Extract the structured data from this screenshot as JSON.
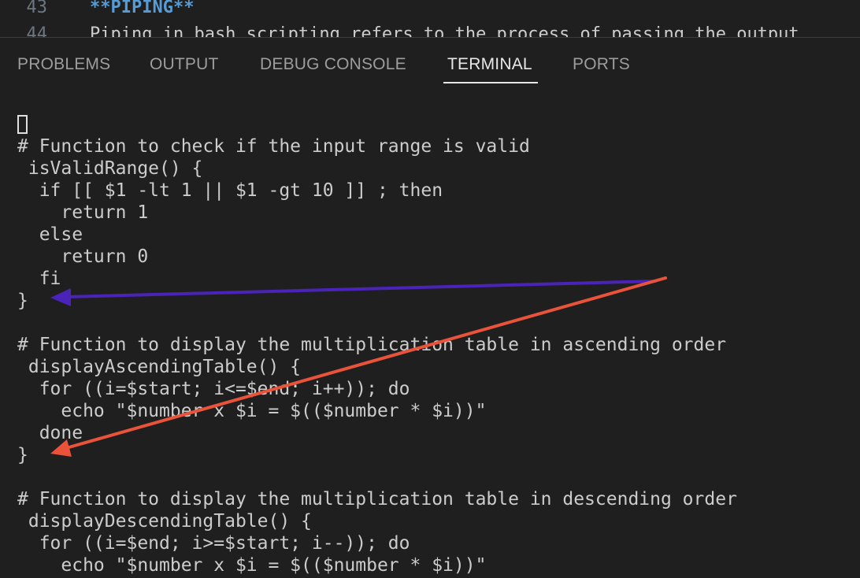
{
  "editor": {
    "lines": [
      {
        "number": "43",
        "text": "**PIPING**"
      },
      {
        "number": "44",
        "text": "Piping in bash scripting refers to the process of passing the output"
      }
    ]
  },
  "panel": {
    "tabs": [
      {
        "label": "PROBLEMS",
        "active": false
      },
      {
        "label": "OUTPUT",
        "active": false
      },
      {
        "label": "DEBUG CONSOLE",
        "active": false
      },
      {
        "label": "TERMINAL",
        "active": true
      },
      {
        "label": "PORTS",
        "active": false
      }
    ]
  },
  "terminal": {
    "lines": [
      "# Function to check if the input range is valid",
      " isValidRange() {",
      "  if [[ $1 -lt 1 || $1 -gt 10 ]] ; then",
      "    return 1",
      "  else",
      "    return 0",
      "  fi",
      "}",
      "",
      "# Function to display the multiplication table in ascending order",
      " displayAscendingTable() {",
      "  for ((i=$start; i<=$end; i++)); do",
      "    echo \"$number x $i = $(($number * $i))\"",
      "  done",
      "}",
      "",
      "# Function to display the multiplication table in descending order",
      " displayDescendingTable() {",
      "  for ((i=$end; i>=$start; i--)); do",
      "    echo \"$number x $i = $(($number * $i))\""
    ]
  },
  "annotations": {
    "arrow_1_color": "#4a23b8",
    "arrow_2_color": "#e8533a"
  }
}
